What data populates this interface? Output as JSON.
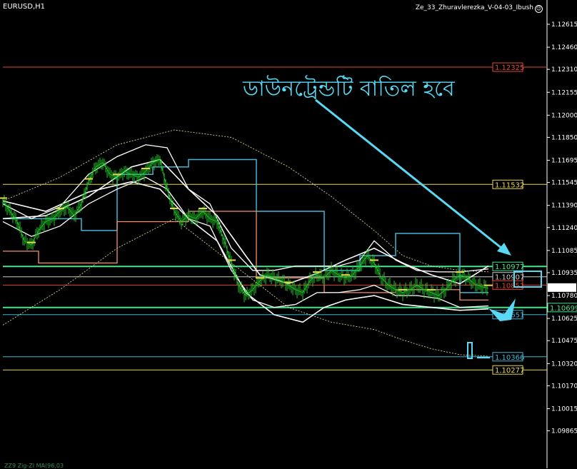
{
  "header": {
    "symbol": "EURUSD,H1",
    "indicator": "Ze_33_Zhuravlerezka_V-04-03_Ibush"
  },
  "annotation": {
    "text": "ডাউনট্রেন্ডটি বাতিল হবে"
  },
  "footer": {
    "text": "ZZ9 Zig-ZI MA(96,03"
  },
  "colors": {
    "background": "#000000",
    "annotation": "#5ad9f5",
    "cyan_line": "#3fb6d8",
    "orange_line": "#f0906a",
    "green_level": "#49e38a",
    "yellow_level": "#e8d84a",
    "red_level": "#e0482f",
    "candle": "#22c42a"
  },
  "chart_data": {
    "type": "line",
    "title": "",
    "xlabel": "",
    "ylabel": "",
    "ylim": [
      1.0958,
      1.1268
    ],
    "y_ticks": [
      1.12615,
      1.1246,
      1.1231,
      1.12155,
      1.12,
      1.1185,
      1.11695,
      1.11545,
      1.1139,
      1.1124,
      1.11085,
      1.10935,
      1.1078,
      1.10625,
      1.10475,
      1.1032,
      1.1017,
      1.10015,
      1.09865
    ],
    "y_tick_labels": [
      "1.12615",
      "1.12460",
      "1.12310",
      "1.12155",
      "1.12000",
      "1.11850",
      "1.11695",
      "1.11545",
      "1.11390",
      "1.11240",
      "1.11085",
      "1.10935",
      "1.10780",
      "1.10625",
      "1.10475",
      "1.10320",
      "1.10170",
      "1.10015",
      "1.09865"
    ],
    "current_price": 1.10834,
    "current_price_label": "1.10834",
    "levels": [
      {
        "price": 1.12325,
        "label": "1.12325",
        "color": "#e0482f"
      },
      {
        "price": 1.11532,
        "label": "1.11532",
        "color": "#e8d84a"
      },
      {
        "price": 1.10977,
        "label": "1.10977",
        "color": "#49e38a"
      },
      {
        "price": 1.10907,
        "label": "1.10907",
        "color": "#cccccc"
      },
      {
        "price": 1.10851,
        "label": "1.10851",
        "color": "#e0482f"
      },
      {
        "price": 1.10699,
        "label": "1.10699",
        "color": "#49e38a"
      },
      {
        "price": 1.10651,
        "label": "1.10651",
        "color": "#3fb6d8"
      },
      {
        "price": 1.10366,
        "label": "1.10366",
        "color": "#3fb6d8"
      },
      {
        "price": 1.10277,
        "label": "1.10277",
        "color": "#e8d84a"
      }
    ],
    "series": [
      {
        "kind": "price",
        "x": [
          0,
          10,
          20,
          30,
          40,
          50,
          60,
          70,
          80,
          90,
          100,
          110,
          120,
          130,
          140,
          150,
          160,
          170,
          180,
          190,
          200,
          210,
          220,
          230,
          240,
          250,
          260,
          270,
          280,
          290,
          300,
          310,
          320,
          330,
          340,
          350,
          360,
          370,
          380,
          390,
          400,
          410,
          420,
          430,
          440,
          450,
          460,
          470,
          480,
          490,
          500,
          510,
          520,
          530,
          540,
          550,
          560,
          570,
          580,
          590,
          600,
          610,
          620,
          630,
          640,
          650,
          660,
          670,
          680
        ],
        "y": [
          1.1142,
          1.1135,
          1.1128,
          1.1115,
          1.1112,
          1.1122,
          1.1128,
          1.113,
          1.1135,
          1.1138,
          1.1132,
          1.114,
          1.1155,
          1.1165,
          1.1168,
          1.116,
          1.1158,
          1.1162,
          1.116,
          1.1158,
          1.1162,
          1.1168,
          1.117,
          1.115,
          1.1135,
          1.1128,
          1.1132,
          1.113,
          1.1135,
          1.113,
          1.1128,
          1.1115,
          1.11,
          1.1085,
          1.1078,
          1.1082,
          1.1088,
          1.1092,
          1.109,
          1.1088,
          1.1085,
          1.1082,
          1.108,
          1.1088,
          1.1092,
          1.109,
          1.1095,
          1.1092,
          1.109,
          1.1092,
          1.1098,
          1.1105,
          1.11,
          1.109,
          1.1085,
          1.1082,
          1.108,
          1.1082,
          1.1085,
          1.1082,
          1.108,
          1.1078,
          1.1082,
          1.1088,
          1.1092,
          1.109,
          1.1086,
          1.1084,
          1.1083
        ]
      },
      {
        "kind": "band_upper",
        "x": [
          0,
          40,
          80,
          120,
          160,
          200,
          230,
          260,
          290,
          320,
          350,
          380,
          410,
          440,
          470,
          500,
          520,
          550,
          580,
          610,
          640,
          680
        ],
        "y": [
          1.114,
          1.113,
          1.1138,
          1.116,
          1.1172,
          1.118,
          1.1178,
          1.115,
          1.114,
          1.111,
          1.1095,
          1.1095,
          1.1098,
          1.1098,
          1.1098,
          1.1102,
          1.1115,
          1.1102,
          1.1095,
          1.1094,
          1.1094,
          1.1096
        ]
      },
      {
        "kind": "band_lower",
        "x": [
          0,
          40,
          80,
          120,
          160,
          200,
          230,
          260,
          290,
          320,
          350,
          380,
          410,
          440,
          470,
          500,
          520,
          550,
          580,
          610,
          640,
          680
        ],
        "y": [
          1.1128,
          1.1118,
          1.1125,
          1.114,
          1.115,
          1.1158,
          1.115,
          1.113,
          1.1125,
          1.1095,
          1.1075,
          1.107,
          1.1072,
          1.108,
          1.108,
          1.1082,
          1.1085,
          1.1078,
          1.1078,
          1.1076,
          1.107,
          1.1071
        ]
      },
      {
        "kind": "outer_upper",
        "x": [
          0,
          60,
          120,
          180,
          220,
          260,
          300,
          340,
          360,
          400,
          440,
          480,
          520,
          560,
          600,
          640,
          680
        ],
        "y": [
          1.113,
          1.1132,
          1.1145,
          1.1165,
          1.117,
          1.115,
          1.1132,
          1.1105,
          1.1092,
          1.1086,
          1.1093,
          1.1102,
          1.111,
          1.11,
          1.1092,
          1.1086,
          1.1098
        ]
      },
      {
        "kind": "outer_lower",
        "x": [
          0,
          60,
          120,
          180,
          220,
          260,
          300,
          340,
          380,
          420,
          450,
          480,
          520,
          560,
          600,
          640,
          680
        ],
        "y": [
          1.1142,
          1.1135,
          1.1148,
          1.1155,
          1.115,
          1.113,
          1.1115,
          1.108,
          1.1065,
          1.106,
          1.107,
          1.1075,
          1.1078,
          1.1072,
          1.107,
          1.1068,
          1.1069
        ]
      },
      {
        "kind": "envelope_upper",
        "x": [
          0,
          80,
          160,
          240,
          320,
          400,
          460,
          520,
          560,
          600,
          640,
          680
        ],
        "y": [
          1.1142,
          1.1158,
          1.118,
          1.119,
          1.1185,
          1.1165,
          1.1145,
          1.1122,
          1.1105,
          1.1098,
          1.1095,
          1.1094
        ]
      },
      {
        "kind": "envelope_lower",
        "x": [
          0,
          80,
          160,
          240,
          320,
          400,
          460,
          520,
          560,
          600,
          640,
          680
        ],
        "y": [
          1.1058,
          1.1082,
          1.111,
          1.113,
          1.11,
          1.107,
          1.106,
          1.1055,
          1.1048,
          1.1042,
          1.1038,
          1.1037
        ]
      },
      {
        "kind": "cyan_step",
        "x": [
          0,
          110,
          110,
          160,
          160,
          210,
          210,
          260,
          260,
          355,
          355,
          450,
          450,
          500,
          500,
          550,
          550,
          640,
          640,
          680
        ],
        "y": [
          1.113,
          1.113,
          1.1122,
          1.1122,
          1.116,
          1.116,
          1.1165,
          1.1165,
          1.117,
          1.117,
          1.1135,
          1.1135,
          1.1095,
          1.1095,
          1.1105,
          1.1105,
          1.112,
          1.112,
          1.108,
          1.108
        ]
      },
      {
        "kind": "orange_step",
        "x": [
          0,
          50,
          50,
          160,
          160,
          260,
          260,
          355,
          355,
          450,
          450,
          550,
          550,
          640,
          640,
          680
        ],
        "y": [
          1.1108,
          1.1108,
          1.11,
          1.11,
          1.1128,
          1.1128,
          1.1135,
          1.1135,
          1.109,
          1.109,
          1.108,
          1.108,
          1.1082,
          1.1082,
          1.1075,
          1.1075
        ]
      }
    ],
    "current_price_marker": true
  }
}
